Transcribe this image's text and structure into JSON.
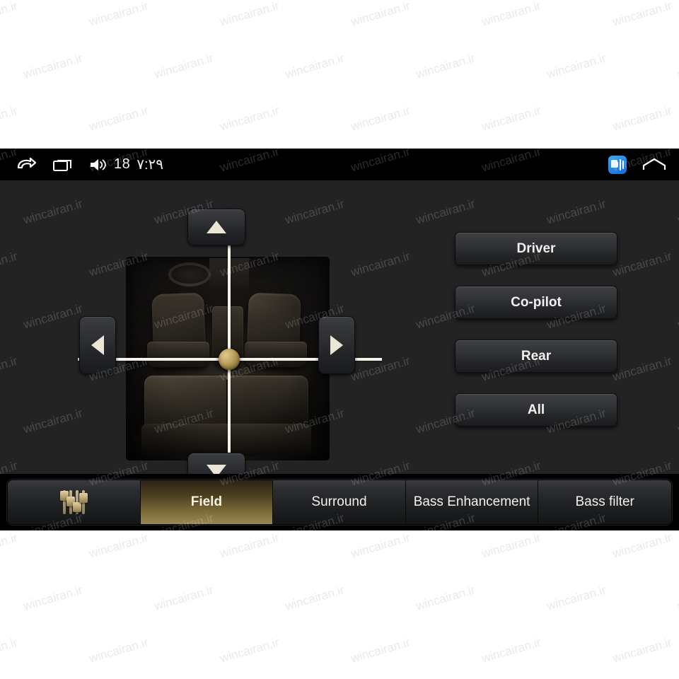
{
  "statusbar": {
    "back_icon": "back-arrow-icon",
    "recents_icon": "recent-apps-icon",
    "volume_icon": "volume-icon",
    "volume_value": "18",
    "time": "٧:٢٩",
    "notification_icon": "music-app-icon",
    "home_icon": "home-icon"
  },
  "field_pad": {
    "up_label": "▲",
    "down_label": "▼",
    "left_label": "◀",
    "right_label": "▶",
    "up_icon": "arrow-up-icon",
    "down_icon": "arrow-down-icon",
    "left_icon": "arrow-left-icon",
    "right_icon": "arrow-right-icon",
    "knob_icon": "sound-position-knob",
    "image_alt": "car-interior-seats-top-view"
  },
  "presets": [
    {
      "label": "Driver"
    },
    {
      "label": "Co-pilot"
    },
    {
      "label": "Rear"
    },
    {
      "label": "All"
    }
  ],
  "reset": {
    "icon": "car-reset-icon"
  },
  "tabs": [
    {
      "label": "",
      "icon": "equalizer-icon",
      "active": false,
      "width_class": "w-icon"
    },
    {
      "label": "Field",
      "icon": "",
      "active": true,
      "width_class": "w-field"
    },
    {
      "label": "Surround",
      "icon": "",
      "active": false,
      "width_class": "w-surr"
    },
    {
      "label": "Bass Enhancement",
      "icon": "",
      "active": false,
      "width_class": "w-bass"
    },
    {
      "label": "Bass filter",
      "icon": "",
      "active": false,
      "width_class": "w-filt"
    }
  ],
  "watermark": {
    "text": "wincairan.ir"
  },
  "colors": {
    "screen_bg": "#232323",
    "statusbar_bg": "#000000",
    "active_tab_gold": "#9a8750",
    "knob_gold": "#c0a562",
    "arrow_cream": "#ece6d4",
    "app_badge_blue": "#1368d6"
  }
}
